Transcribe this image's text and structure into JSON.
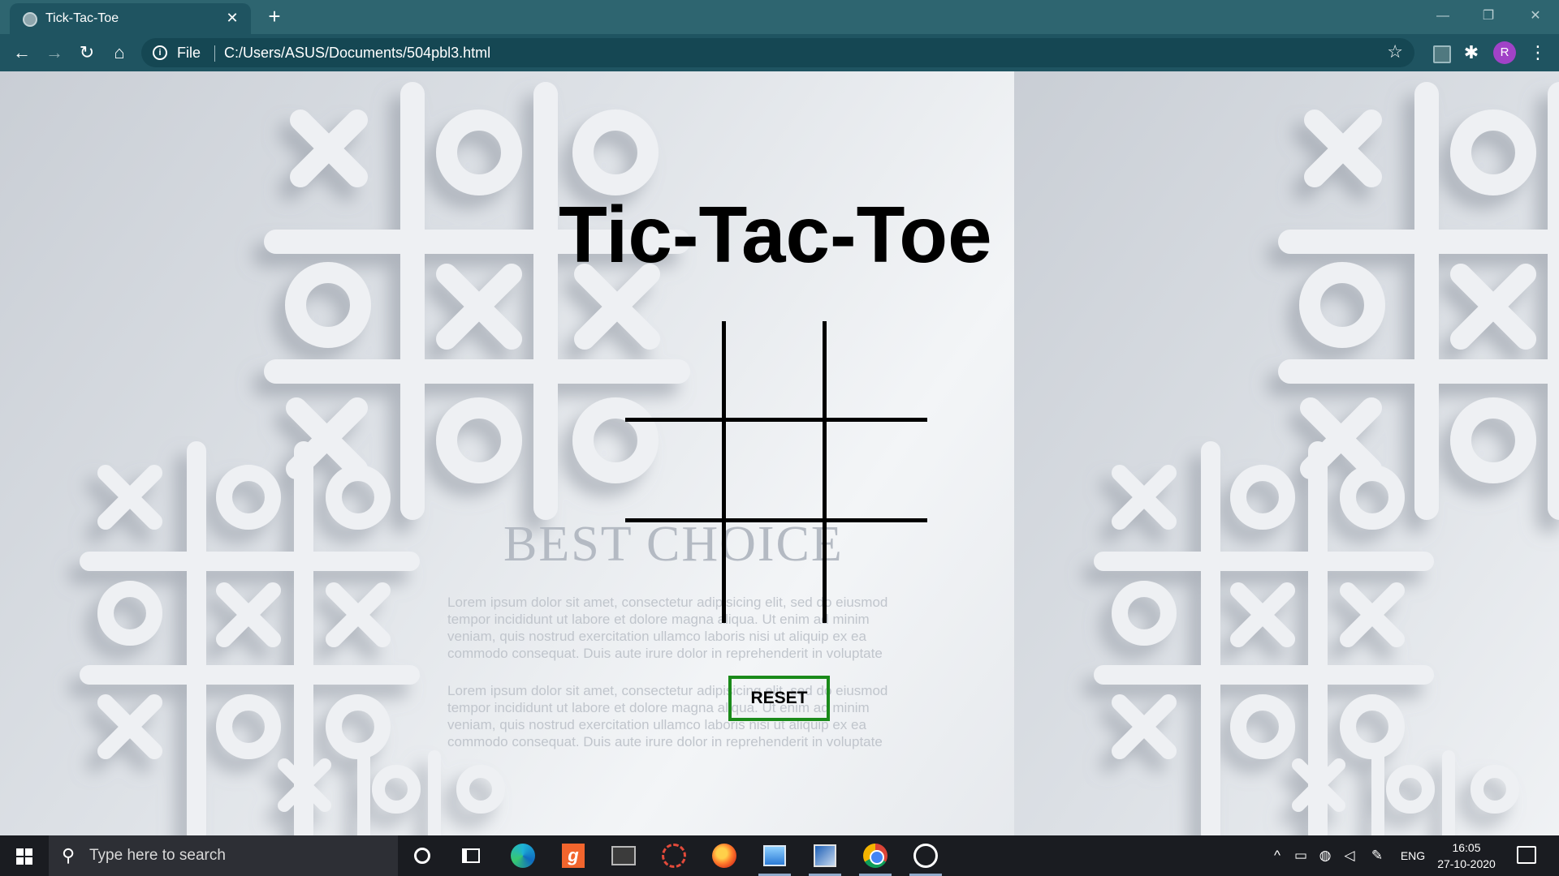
{
  "browser": {
    "tab": {
      "title": "Tick-Tac-Toe",
      "close": "✕"
    },
    "new_tab": "+",
    "window_controls": {
      "minimize": "—",
      "restore": "❐",
      "close": "✕"
    },
    "nav": {
      "back": "←",
      "forward": "→",
      "reload": "↻",
      "home": "⌂"
    },
    "address": {
      "scheme_label": "File",
      "url": "C:/Users/ASUS/Documents/504pbl3.html"
    },
    "star": "☆",
    "puzzle": "✱",
    "profile_initial": "R",
    "menu": "⋮"
  },
  "page": {
    "title": "Tic-Tac-Toe",
    "board": {
      "cells": [
        "",
        "",
        "",
        "",
        "",
        "",
        "",
        "",
        ""
      ]
    },
    "reset_label": "RESET",
    "background": {
      "tagline": "BEST CHOICE",
      "lorem": [
        "Lorem ipsum dolor sit amet, consectetur adipisicing elit, sed do eiusmod tempor incididunt ut labore et dolore magna aliqua. Ut enim ad minim veniam, quis nostrud exercitation ullamco laboris nisi ut aliquip ex ea commodo consequat. Duis aute irure dolor in reprehenderit in voluptate",
        "Lorem ipsum dolor sit amet, consectetur adipisicing elit, sed do eiusmod tempor incididunt ut labore et dolore magna aliqua. Ut enim ad minim veniam, quis nostrud exercitation ullamco laboris nisi ut aliquip ex ea commodo consequat. Duis aute irure dolor in reprehenderit in voluptate"
      ]
    }
  },
  "taskbar": {
    "search_placeholder": "Type here to search",
    "search_glyph": "⚲",
    "g_label": "g",
    "tray": {
      "chevron": "^",
      "language": "ENG",
      "time": "16:05",
      "date": "27-10-2020"
    }
  },
  "colors": {
    "reset_border": "#1a8a1a",
    "titlebar": "#2e6570",
    "toolbar": "#1f5461",
    "taskbar": "#1a1c21"
  }
}
